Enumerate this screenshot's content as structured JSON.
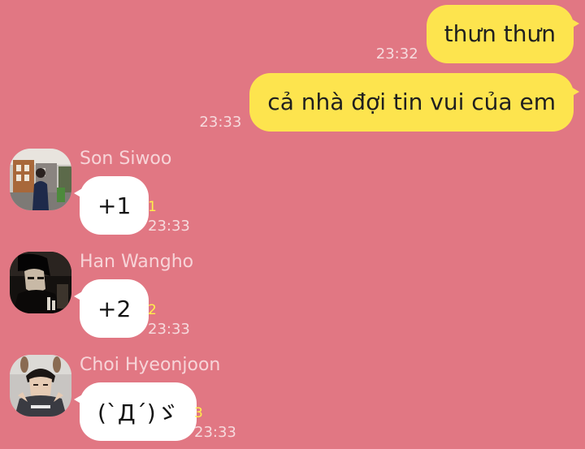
{
  "outgoing": [
    {
      "text": "thưn thưn",
      "time": "23:32"
    },
    {
      "text": "cả nhà đợi tin vui của em",
      "time": "23:33"
    }
  ],
  "incoming": [
    {
      "sender": "Son Siwoo",
      "text": "+1",
      "unread": "1",
      "time": "23:33",
      "avatar_icon": "avatar-street-photo"
    },
    {
      "sender": "Han Wangho",
      "text": "+2",
      "unread": "2",
      "time": "23:33",
      "avatar_icon": "avatar-dark-photo"
    },
    {
      "sender": "Choi Hyeonjoon",
      "text": "(`Д´)ゞ",
      "unread": "3",
      "time": "23:33",
      "avatar_icon": "avatar-person-photo"
    }
  ],
  "colors": {
    "background": "#e17783",
    "outgoing_bubble": "#fde44e",
    "incoming_bubble": "#ffffff",
    "unread_count": "#fff04b"
  }
}
